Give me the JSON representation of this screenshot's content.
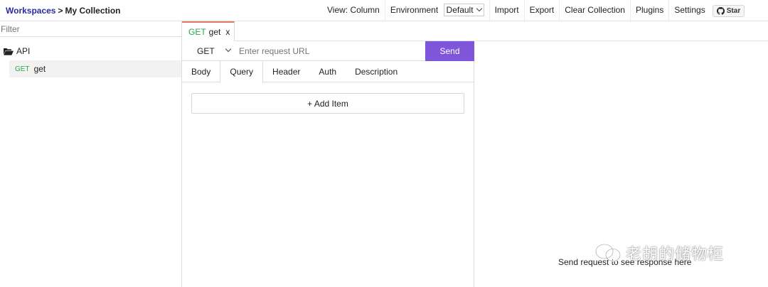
{
  "breadcrumb": {
    "workspace": "Workspaces",
    "separator": ">",
    "collection": "My Collection"
  },
  "menu": {
    "view": "View: Column",
    "environment_label": "Environment",
    "environment_value": "Default",
    "import": "Import",
    "export": "Export",
    "clear": "Clear Collection",
    "plugins": "Plugins",
    "settings": "Settings",
    "star": "Star"
  },
  "sidebar": {
    "filter_placeholder": "Filter",
    "folder": "API",
    "items": [
      {
        "method": "GET",
        "name": "get"
      }
    ]
  },
  "tab": {
    "method": "GET",
    "name": "get",
    "close": "x"
  },
  "request": {
    "method": "GET",
    "url_placeholder": "Enter request URL",
    "send": "Send",
    "tabs": [
      "Body",
      "Query",
      "Header",
      "Auth",
      "Description"
    ],
    "active_tab": "Query",
    "add_item": "+ Add Item"
  },
  "response": {
    "empty_message": "Send request to see response here"
  },
  "watermark": {
    "text": "老胡的储物柜"
  },
  "colors": {
    "accent": "#7f56d9",
    "get_method": "#28a745",
    "breadcrumb_link": "#2a2aa0",
    "tab_top": "#e07a5f"
  }
}
